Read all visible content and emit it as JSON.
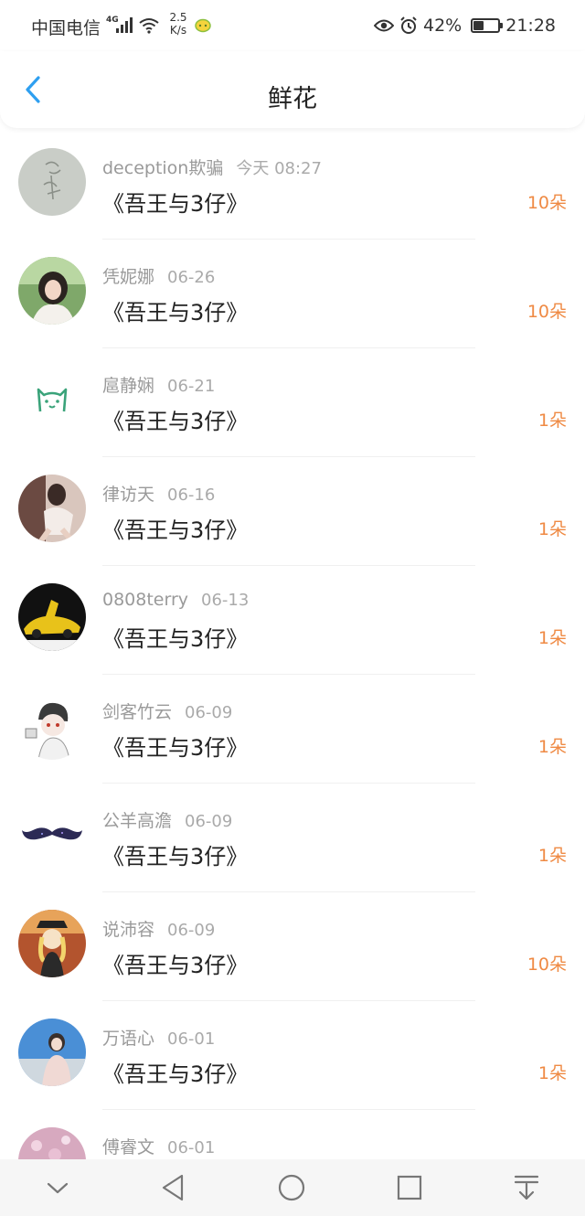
{
  "status_bar": {
    "carrier": "中国电信",
    "network": "4G",
    "speed_value": "2.5",
    "speed_unit": "K/s",
    "battery": "42%",
    "battery_level": 0.42,
    "time": "21:28"
  },
  "header": {
    "title": "鲜花"
  },
  "colors": {
    "accent_blue": "#2e9ff0",
    "count_orange": "#ef8a44"
  },
  "records": [
    {
      "user": "deception欺骗",
      "time": "今天 08:27",
      "book": "《吾王与3仔》",
      "count": "10朵",
      "avatar_icon": "sketch-avatar-icon"
    },
    {
      "user": "凭妮娜",
      "time": "06-26",
      "book": "《吾王与3仔》",
      "count": "10朵",
      "avatar_icon": "girl-photo-avatar-icon"
    },
    {
      "user": "扈静娴",
      "time": "06-21",
      "book": "《吾王与3仔》",
      "count": "1朵",
      "avatar_icon": "dog-line-avatar-icon"
    },
    {
      "user": "律访天",
      "time": "06-16",
      "book": "《吾王与3仔》",
      "count": "1朵",
      "avatar_icon": "girl-sitting-avatar-icon"
    },
    {
      "user": "0808terry",
      "time": "06-13",
      "book": "《吾王与3仔》",
      "count": "1朵",
      "avatar_icon": "sports-car-avatar-icon"
    },
    {
      "user": "剑客竹云",
      "time": "06-09",
      "book": "《吾王与3仔》",
      "count": "1朵",
      "avatar_icon": "anime-boy-avatar-icon"
    },
    {
      "user": "公羊高澹",
      "time": "06-09",
      "book": "《吾王与3仔》",
      "count": "1朵",
      "avatar_icon": "mustache-avatar-icon"
    },
    {
      "user": "说沛容",
      "time": "06-09",
      "book": "《吾王与3仔》",
      "count": "10朵",
      "avatar_icon": "anime-girl-avatar-icon"
    },
    {
      "user": "万语心",
      "time": "06-01",
      "book": "《吾王与3仔》",
      "count": "1朵",
      "avatar_icon": "girl-sky-avatar-icon"
    },
    {
      "user": "傅睿文",
      "time": "06-01",
      "book": "",
      "count": "",
      "avatar_icon": "pink-photo-avatar-icon"
    }
  ],
  "nav": {
    "icons": [
      "chevron-down-icon",
      "back-triangle-icon",
      "home-circle-icon",
      "recents-square-icon",
      "download-arrow-icon"
    ]
  }
}
